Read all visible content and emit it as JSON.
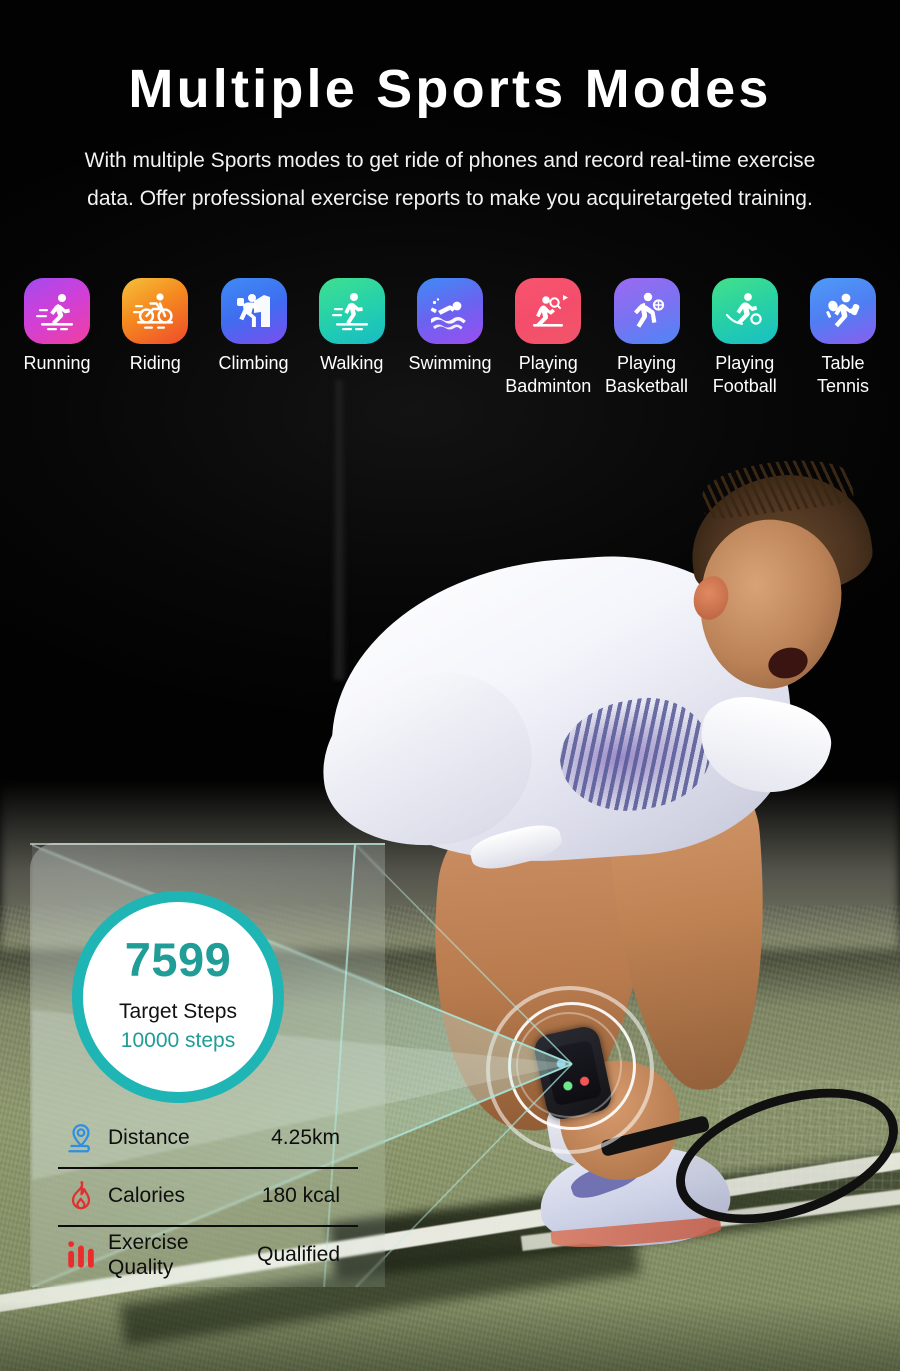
{
  "header": {
    "title": "Multiple Sports Modes",
    "subtitle": "With multiple Sports modes to get ride of phones and record real-time exercise data. Offer professional exercise reports to make you acquiretargeted training."
  },
  "sports": [
    {
      "label": "Running",
      "icon": "running-icon",
      "gradient_class": "g-running",
      "colors": [
        "#a24bf0",
        "#f13fa0"
      ]
    },
    {
      "label": "Riding",
      "icon": "cycling-icon",
      "gradient_class": "g-riding",
      "colors": [
        "#f5c13a",
        "#ee4b2b"
      ]
    },
    {
      "label": "Climbing",
      "icon": "climbing-icon",
      "gradient_class": "g-climbing",
      "colors": [
        "#3f8bf5",
        "#7a4ef0"
      ]
    },
    {
      "label": "Walking",
      "icon": "walking-icon",
      "gradient_class": "g-walking",
      "colors": [
        "#3fe08f",
        "#17bcc4"
      ]
    },
    {
      "label": "Swimming",
      "icon": "swimming-icon",
      "gradient_class": "g-swimming",
      "colors": [
        "#3f8cf5",
        "#9b4ef0"
      ]
    },
    {
      "label": "Playing\nBadminton",
      "icon": "badminton-icon",
      "gradient_class": "g-badminton",
      "colors": [
        "#f7556f",
        "#f0566a"
      ]
    },
    {
      "label": "Playing\nBasketball",
      "icon": "basketball-icon",
      "gradient_class": "g-basketball",
      "colors": [
        "#9b6af0",
        "#4f86f5"
      ]
    },
    {
      "label": "Playing\nFootball",
      "icon": "football-icon",
      "gradient_class": "g-football",
      "colors": [
        "#43e08a",
        "#18bfc6"
      ]
    },
    {
      "label": "Table\nTennis",
      "icon": "table-tennis-icon",
      "gradient_class": "g-tabletennis",
      "colors": [
        "#4d9bf7",
        "#8b5ef0"
      ]
    }
  ],
  "stats_panel": {
    "steps": {
      "value": "7599",
      "label": "Target Steps",
      "goal": "10000 steps",
      "ring_color": "#20b5b5",
      "value_color": "#1f9d96"
    },
    "rows": [
      {
        "name": "Distance",
        "value": "4.25km",
        "icon": "location-pin-icon",
        "icon_color": "#2f8fe0"
      },
      {
        "name": "Calories",
        "value": "180 kcal",
        "icon": "flame-icon",
        "icon_color": "#e03030"
      },
      {
        "name": "Exercise\nQuality",
        "value": "Qualified",
        "icon": "bar-chart-icon",
        "icon_color": "#ea2c2c"
      }
    ]
  }
}
